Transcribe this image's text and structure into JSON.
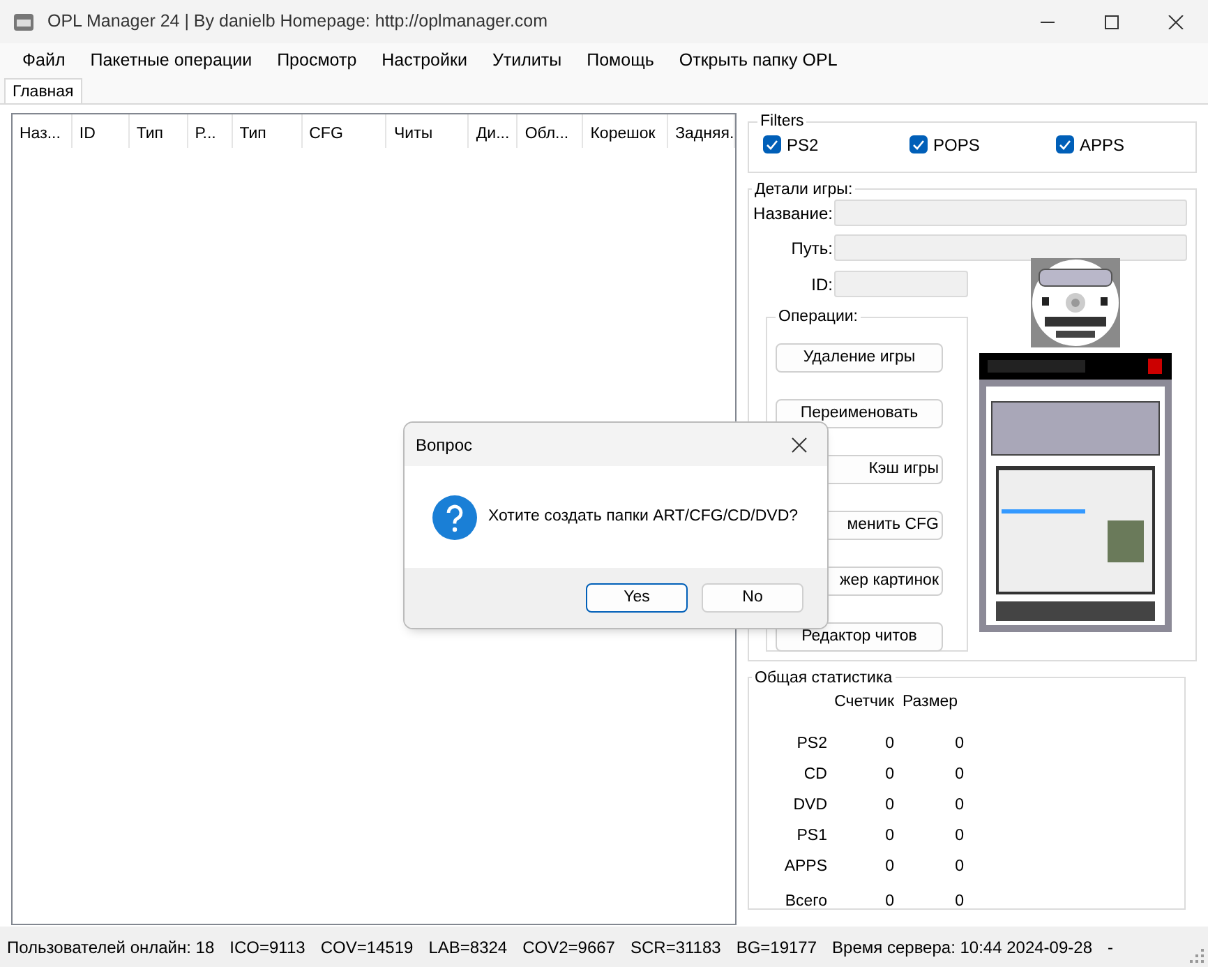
{
  "window": {
    "title": "OPL Manager 24 | By danielb Homepage: http://oplmanager.com"
  },
  "menu": [
    "Файл",
    "Пакетные операции",
    "Просмотр",
    "Настройки",
    "Утилиты",
    "Помощь",
    "Открыть папку OPL"
  ],
  "tabs": [
    {
      "label": "Главная",
      "selected": true
    }
  ],
  "game_list": {
    "columns": [
      "Наз...",
      "ID",
      "Тип",
      "Р...",
      "Тип",
      "CFG",
      "Читы",
      "Ди...",
      "Обл...",
      "Корешок",
      "Задняя."
    ]
  },
  "filters": {
    "title": "Filters",
    "items": [
      {
        "label": "PS2",
        "checked": true
      },
      {
        "label": "POPS",
        "checked": true
      },
      {
        "label": "APPS",
        "checked": true
      }
    ]
  },
  "details": {
    "title": "Детали игры:",
    "fields": [
      {
        "label": "Название:",
        "kind": "wide"
      },
      {
        "label": "Путь:",
        "kind": "wide"
      },
      {
        "label": "ID:",
        "kind": "short"
      }
    ],
    "operations": {
      "title": "Операции:",
      "buttons": [
        {
          "label": "Удаление игры",
          "kind": "full"
        },
        {
          "label": "Переименовать",
          "kind": "full"
        },
        {
          "label": "Кэш игры",
          "kind": "clipped"
        },
        {
          "label": "менить CFG",
          "kind": "clipped"
        },
        {
          "label": "жер картинок",
          "kind": "clipped"
        },
        {
          "label": "Редактор читов",
          "kind": "full"
        }
      ]
    }
  },
  "stats": {
    "title": "Общая статистика",
    "columns": [
      "Счетчик",
      "Размер"
    ],
    "rows": [
      {
        "label": "PS2",
        "count": "0",
        "size": "0"
      },
      {
        "label": "CD",
        "count": "0",
        "size": "0"
      },
      {
        "label": "DVD",
        "count": "0",
        "size": "0"
      },
      {
        "label": "PS1",
        "count": "0",
        "size": "0"
      },
      {
        "label": "APPS",
        "count": "0",
        "size": "0"
      },
      {
        "label": "Всего",
        "count": "0",
        "size": "0"
      }
    ]
  },
  "status_bar": [
    "Пользователей онлайн: 18",
    "ICO=9113",
    "COV=14519",
    "LAB=8324",
    "COV2=9667",
    "SCR=31183",
    "BG=19177",
    "Время сервера: 10:44 2024-09-28",
    "-"
  ],
  "dialog": {
    "title": "Вопрос",
    "message": "Хотите создать папки ART/CFG/CD/DVD?",
    "buttons": [
      {
        "label": "Yes",
        "default": true
      },
      {
        "label": "No",
        "default": false
      }
    ]
  }
}
